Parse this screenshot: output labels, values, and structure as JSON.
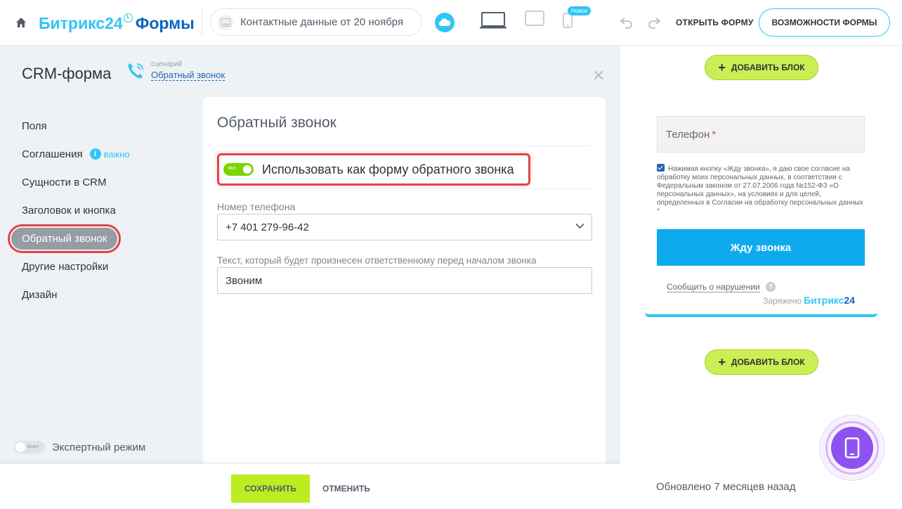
{
  "header": {
    "brand_name": "Битрикс24",
    "brand_product": "Формы",
    "form_name": "Контактные данные от 20 ноября",
    "new_badge": "Новое",
    "open_form": "ОТКРЫТЬ ФОРМУ",
    "form_features": "ВОЗМОЖНОСТИ ФОРМЫ"
  },
  "sidebar": {
    "title": "CRM-форма",
    "scenario_caption": "сценарий",
    "scenario_name": "Обратный звонок",
    "items": [
      {
        "label": "Поля"
      },
      {
        "label": "Соглашения",
        "badge": "важно"
      },
      {
        "label": "Сущности в CRM"
      },
      {
        "label": "Заголовок и кнопка"
      },
      {
        "label": "Обратный звонок",
        "active": true
      },
      {
        "label": "Другие настройки"
      },
      {
        "label": "Дизайн"
      }
    ],
    "expert_toggle_label": "выкл",
    "expert_mode": "Экспертный режим"
  },
  "card": {
    "title": "Обратный звонок",
    "toggle_label": "вкл",
    "toggle_text": "Использовать как форму обратного звонка",
    "phone_label": "Номер телефона",
    "phone_value": "+7 401 279-96-42",
    "text_label": "Текст, который будет произнесен ответственному перед началом звонка",
    "text_value": "Звоним"
  },
  "footer": {
    "save": "СОХРАНИТЬ",
    "cancel": "ОТМЕНИТЬ"
  },
  "preview": {
    "add_block": "ДОБАВИТЬ БЛОК",
    "phone_placeholder": "Телефон",
    "required_mark": "*",
    "consent_text": "Нажимая кнопку «Жду звонка», я даю свое согласие на обработку моих персональных данных, в соответствии с Федеральным законом от 27.07.2006 года №152-ФЗ «О персональных данных», на условиях и для целей, определенных в Согласии на обработку персональных данных",
    "submit": "Жду звонка",
    "report": "Сообщить о нарушении",
    "help_mark": "?",
    "powered_by": "Заряжено",
    "powered_brand": "Битрикс",
    "powered_num": "24",
    "updated": "Обновлено 7 месяцев назад"
  },
  "colors": {
    "accent": "#2fc6f6",
    "save_green": "#bbed21",
    "highlight_red": "#e2434b",
    "submit_blue": "#0dabee",
    "fab_purple": "#8d52f0"
  },
  "icons": [
    "home-icon",
    "image-icon",
    "cloud-icon",
    "desktop-icon",
    "tablet-icon",
    "mobile-icon",
    "undo-icon",
    "redo-icon",
    "phone-icon",
    "close-icon",
    "info-icon",
    "chevron-down-icon",
    "plus-icon",
    "mobile-preview-icon"
  ]
}
